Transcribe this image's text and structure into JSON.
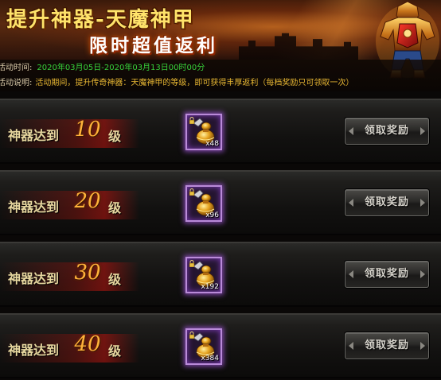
{
  "banner": {
    "title_line1": "提升神器-天魔神甲",
    "title_line2": "限时超值返利",
    "icons": [
      "warrior-figure",
      "castle-silhouette"
    ]
  },
  "info": {
    "time_label": "活动时间:",
    "time_value": "2020年03月05日-2020年03月13日00时00分",
    "desc_label": "活动说明:",
    "desc_value": "活动期间，提升传奇神器：天魔神甲的等级，即可获得丰厚返利（每档奖励只可领取一次）"
  },
  "rewards": [
    {
      "prefix": "神器达到",
      "level": "10",
      "unit": "级",
      "item_count": "x48",
      "button_label": "领取奖励"
    },
    {
      "prefix": "神器达到",
      "level": "20",
      "unit": "级",
      "item_count": "x96",
      "button_label": "领取奖励"
    },
    {
      "prefix": "神器达到",
      "level": "30",
      "unit": "级",
      "item_count": "x192",
      "button_label": "领取奖励"
    },
    {
      "prefix": "神器达到",
      "level": "40",
      "unit": "级",
      "item_count": "x384",
      "button_label": "领取奖励"
    }
  ],
  "colors": {
    "date_green": "#37d23a",
    "desc_gold": "#e8b733",
    "level_orange": "#ffb23a",
    "item_border_purple": "#b98ad8"
  }
}
